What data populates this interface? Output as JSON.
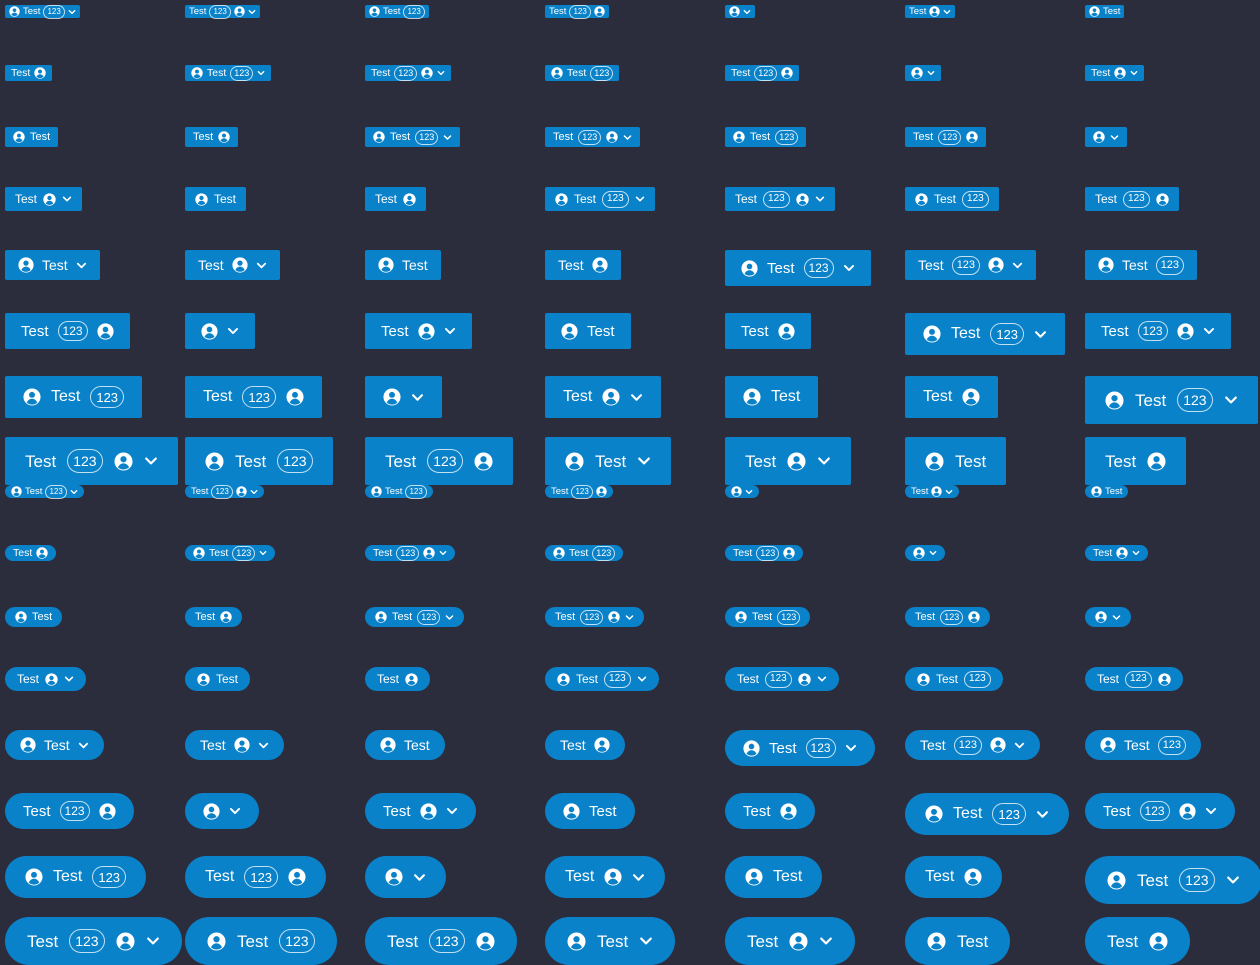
{
  "button": {
    "label": "Test",
    "badge": "123",
    "background": "#0a82c9",
    "text_color": "#ffffff",
    "icons": {
      "user": "user-circle-icon",
      "dropdown": "chevron-down-icon"
    }
  },
  "page": {
    "background": "#2b2d3d"
  },
  "groups": [
    {
      "name": "square",
      "pill": false
    },
    {
      "name": "rounded",
      "pill": true
    }
  ]
}
